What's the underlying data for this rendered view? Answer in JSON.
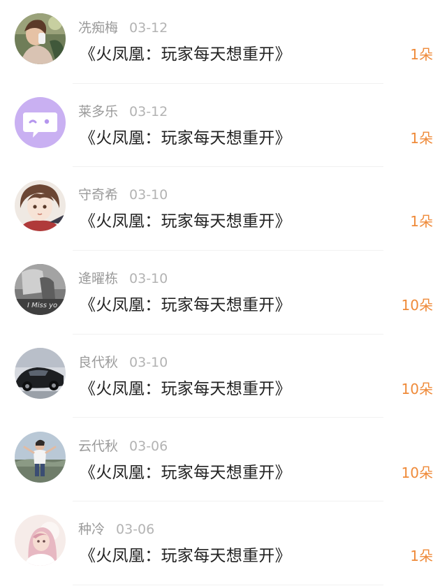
{
  "colors": {
    "accent": "#ef8a39",
    "name_text": "#9a9a9a",
    "date_text": "#b3b3b3",
    "title_text": "#222222",
    "divider": "#f1f1f1"
  },
  "gift_list": {
    "items": [
      {
        "avatar": "avatar-photo-woman-drinking-icon",
        "name": "冼痴梅",
        "date": "03-12",
        "title": "《火凤凰：玩家每天想重开》",
        "amount": "1朵"
      },
      {
        "avatar": "avatar-purple-chat-bubble-icon",
        "name": "莱多乐",
        "date": "03-12",
        "title": "《火凤凰：玩家每天想重开》",
        "amount": "1朵"
      },
      {
        "avatar": "avatar-anime-girl-icon",
        "name": "守奇希",
        "date": "03-10",
        "title": "《火凤凰：玩家每天想重开》",
        "amount": "1朵"
      },
      {
        "avatar": "avatar-grayscale-photo-icon",
        "name": "逄曜栋",
        "date": "03-10",
        "title": "《火凤凰：玩家每天想重开》",
        "amount": "10朵",
        "avatar_text": "I Miss yo"
      },
      {
        "avatar": "avatar-sports-car-icon",
        "name": "良代秋",
        "date": "03-10",
        "title": "《火凤凰：玩家每天想重开》",
        "amount": "10朵"
      },
      {
        "avatar": "avatar-child-outdoors-icon",
        "name": "云代秋",
        "date": "03-06",
        "title": "《火凤凰：玩家每天想重开》",
        "amount": "10朵"
      },
      {
        "avatar": "avatar-girl-pink-hair-icon",
        "name": "种冷",
        "date": "03-06",
        "title": "《火凤凰：玩家每天想重开》",
        "amount": "1朵"
      }
    ]
  }
}
